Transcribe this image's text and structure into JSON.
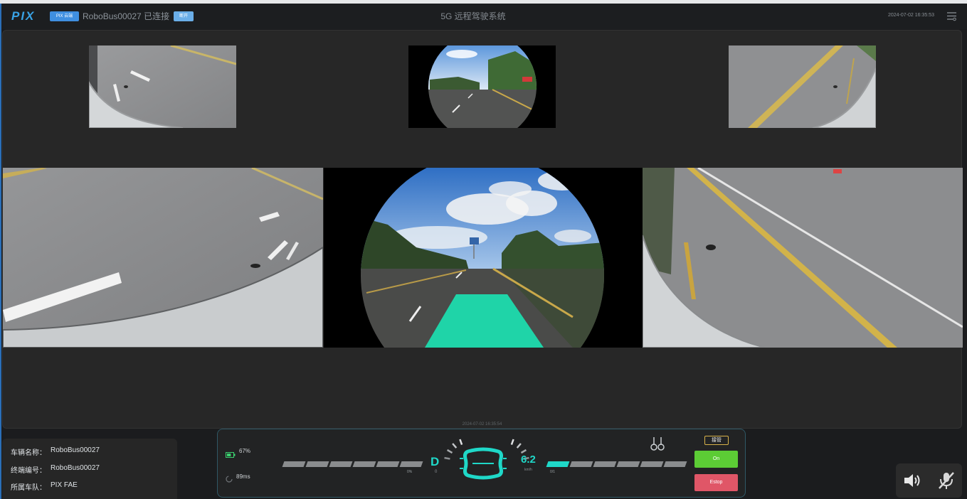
{
  "header": {
    "logo": "PIX",
    "badge": "PIX 云端",
    "vehicle": "RoboBus00027 已连接",
    "action_button": "断开",
    "title": "5G 远程驾驶系统",
    "datetime": "2024-07-02 16:35:53",
    "menu_icon": "menu-icon"
  },
  "video": {
    "timestamp": "2024-07-02 16:35:54",
    "path_overlay_color": "#1fd4a8"
  },
  "vehicle_info": [
    {
      "label": "车辆名称：",
      "value": "RoboBus00027"
    },
    {
      "label": "终端编号：",
      "value": "RoboBus00027"
    },
    {
      "label": "所属车队：",
      "value": "PIX FAE"
    }
  ],
  "dashboard": {
    "battery_icon": "battery-icon",
    "battery": "67%",
    "battery_level": 0.67,
    "latency_icon": "signal-icon",
    "latency": "89ms",
    "throttle_label": "0%",
    "throttle_level": 0,
    "gear": "D",
    "gear_sub": "0",
    "steering_icon": "steering-wheel-icon",
    "speed": "6.2",
    "speed_unit": "km/h",
    "brake_label": "0/1",
    "brake_level": 0.17,
    "joystick_icon": "joystick-icon",
    "takeover_label": "接管",
    "start_button": "On",
    "estop_button": "Estop"
  },
  "audio": {
    "volume_icon": "volume-icon",
    "mic_icon": "mic-muted-icon"
  },
  "colors": {
    "accent": "#1fd8c8",
    "start": "#5ccc35",
    "estop": "#e05667",
    "badge": "#3f8fe0",
    "battery": "#3bd16f"
  }
}
